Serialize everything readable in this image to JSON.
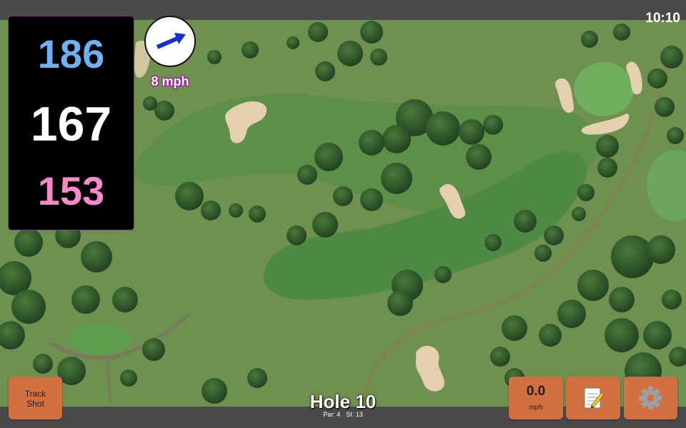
{
  "status": {
    "time": "10:10"
  },
  "distances": {
    "back": "186",
    "middle": "167",
    "front": "153"
  },
  "wind": {
    "speed_label": "8 mph",
    "direction_icon": "arrow-icon"
  },
  "buttons": {
    "track_shot": "Track Shot",
    "speed_value": "0.0",
    "speed_unit": "mph",
    "notes_icon": "notepad-icon",
    "settings_icon": "gear-icon"
  },
  "hole": {
    "title": "Hole 10",
    "par": "Par: 4",
    "stroke_index": "SI: 13"
  },
  "colors": {
    "back_distance": "#6fb0f2",
    "middle_distance": "#ffffff",
    "front_distance": "#f68ac8",
    "button": "#d2713f",
    "bar": "#4a4a4a"
  }
}
